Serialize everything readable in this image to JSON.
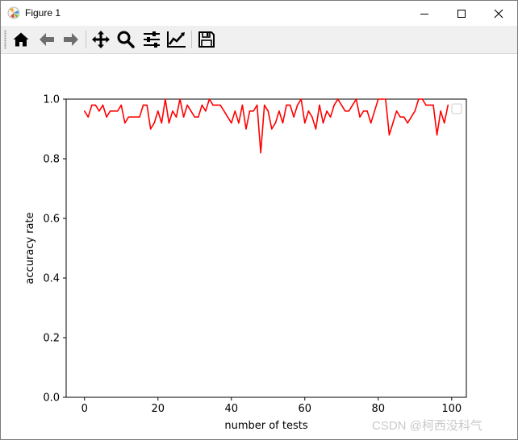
{
  "window": {
    "title": "Figure 1",
    "app_icon": "matplotlib-figure-icon",
    "controls": [
      "minimize-icon",
      "maximize-icon",
      "close-icon"
    ]
  },
  "toolbar": {
    "buttons": [
      {
        "name": "home",
        "icon": "home-icon"
      },
      {
        "name": "back",
        "icon": "arrow-left-icon"
      },
      {
        "name": "forward",
        "icon": "arrow-right-icon"
      },
      {
        "name": "pan",
        "icon": "move-arrows-icon"
      },
      {
        "name": "zoom",
        "icon": "magnifier-icon"
      },
      {
        "name": "configure-subplots",
        "icon": "sliders-icon"
      },
      {
        "name": "edit-axis",
        "icon": "line-chart-icon"
      },
      {
        "name": "save",
        "icon": "floppy-disk-icon"
      }
    ]
  },
  "chart_data": {
    "type": "line",
    "title": "",
    "xlabel": "number of tests",
    "ylabel": "accuracy rate",
    "xlim": [
      -5,
      104
    ],
    "ylim": [
      0.0,
      1.0
    ],
    "xticks": [
      0,
      20,
      40,
      60,
      80,
      100
    ],
    "xtick_labels": [
      "0",
      "20",
      "40",
      "60",
      "80",
      "100"
    ],
    "yticks": [
      0.0,
      0.2,
      0.4,
      0.6,
      0.8,
      1.0
    ],
    "ytick_labels": [
      "0.0",
      "0.2",
      "0.4",
      "0.6",
      "0.8",
      "1.0"
    ],
    "grid": false,
    "legend": {
      "placement": "top-right",
      "entries": []
    },
    "series": [
      {
        "color": "#ff0000",
        "x": [
          0,
          1,
          2,
          3,
          4,
          5,
          6,
          7,
          8,
          9,
          10,
          11,
          12,
          13,
          14,
          15,
          16,
          17,
          18,
          19,
          20,
          21,
          22,
          23,
          24,
          25,
          26,
          27,
          28,
          29,
          30,
          31,
          32,
          33,
          34,
          35,
          36,
          37,
          38,
          39,
          40,
          41,
          42,
          43,
          44,
          45,
          46,
          47,
          48,
          49,
          50,
          51,
          52,
          53,
          54,
          55,
          56,
          57,
          58,
          59,
          60,
          61,
          62,
          63,
          64,
          65,
          66,
          67,
          68,
          69,
          70,
          71,
          72,
          73,
          74,
          75,
          76,
          77,
          78,
          79,
          80,
          81,
          82,
          83,
          84,
          85,
          86,
          87,
          88,
          89,
          90,
          91,
          92,
          93,
          94,
          95,
          96,
          97,
          98,
          99
        ],
        "values": [
          0.96,
          0.94,
          0.98,
          0.98,
          0.96,
          0.98,
          0.94,
          0.96,
          0.96,
          0.96,
          0.98,
          0.92,
          0.94,
          0.94,
          0.94,
          0.94,
          0.98,
          0.98,
          0.9,
          0.92,
          0.96,
          0.92,
          1.0,
          0.92,
          0.96,
          0.94,
          1.0,
          0.94,
          0.98,
          0.96,
          0.94,
          0.94,
          0.98,
          0.96,
          1.0,
          0.98,
          0.98,
          0.98,
          0.96,
          0.94,
          0.92,
          0.96,
          0.92,
          0.98,
          0.9,
          0.96,
          0.96,
          0.98,
          0.82,
          0.98,
          0.96,
          0.9,
          0.92,
          0.96,
          0.92,
          0.98,
          0.98,
          0.94,
          0.98,
          1.0,
          0.92,
          0.96,
          0.94,
          0.9,
          0.98,
          0.92,
          0.96,
          0.94,
          0.98,
          1.0,
          0.98,
          0.96,
          0.96,
          0.98,
          1.0,
          0.94,
          0.96,
          0.96,
          0.92,
          0.96,
          1.0,
          1.0,
          1.0,
          0.88,
          0.92,
          0.96,
          0.94,
          0.94,
          0.92,
          0.94,
          0.96,
          1.0,
          1.0,
          0.98,
          0.98,
          0.98,
          0.88,
          0.96,
          0.92,
          0.98
        ]
      }
    ]
  },
  "watermark": "CSDN @柯西没科气"
}
